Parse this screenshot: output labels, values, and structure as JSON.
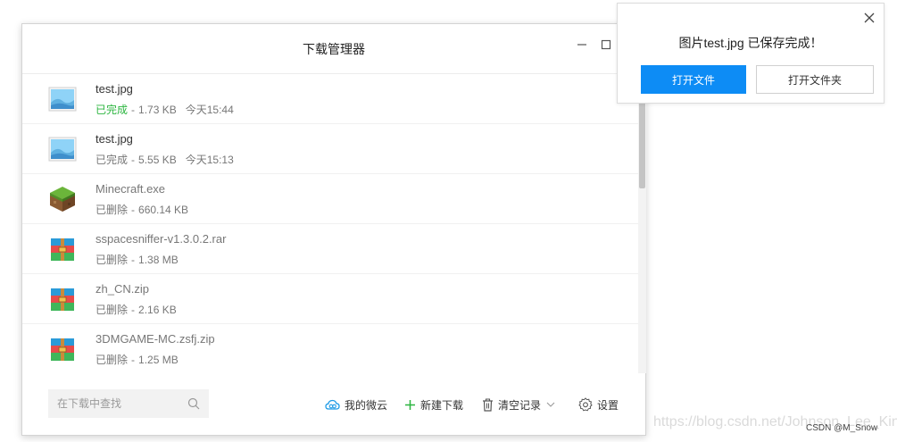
{
  "window": {
    "title": "下载管理器"
  },
  "downloads": [
    {
      "name": "test.jpg",
      "status": "已完成",
      "size": "1.73 KB",
      "time": "今天15:44",
      "icon": "image-file-icon",
      "state": "completed-highlight"
    },
    {
      "name": "test.jpg",
      "status": "已完成",
      "size": "5.55 KB",
      "time": "今天15:13",
      "icon": "image-file-icon",
      "state": "completed"
    },
    {
      "name": "Minecraft.exe",
      "status": "已删除",
      "size": "660.14 KB",
      "time": "",
      "icon": "minecraft-block-icon",
      "state": "deleted"
    },
    {
      "name": "sspacesniffer-v1.3.0.2.rar",
      "status": "已删除",
      "size": "1.38 MB",
      "time": "",
      "icon": "archive-file-icon",
      "state": "deleted"
    },
    {
      "name": "zh_CN.zip",
      "status": "已删除",
      "size": "2.16 KB",
      "time": "",
      "icon": "archive-file-icon",
      "state": "deleted"
    },
    {
      "name": "3DMGAME-MC.zsfj.zip",
      "status": "已删除",
      "size": "1.25 MB",
      "time": "",
      "icon": "archive-file-icon",
      "state": "deleted"
    }
  ],
  "footer": {
    "search_placeholder": "在下载中查找",
    "cloud_label": "我的微云",
    "new_download_label": "新建下载",
    "clear_label": "清空记录",
    "settings_label": "设置"
  },
  "toast": {
    "message": "图片test.jpg 已保存完成！",
    "open_file_label": "打开文件",
    "open_folder_label": "打开文件夹"
  },
  "watermark": "https://blog.csdn.net/Johnson_Lee_King",
  "credit": "CSDN @M_Snow",
  "colors": {
    "accent": "#0d8cf5",
    "success": "#2bb53f",
    "cloud_icon": "#1f9be6",
    "new_download_icon": "#2bb53f"
  }
}
